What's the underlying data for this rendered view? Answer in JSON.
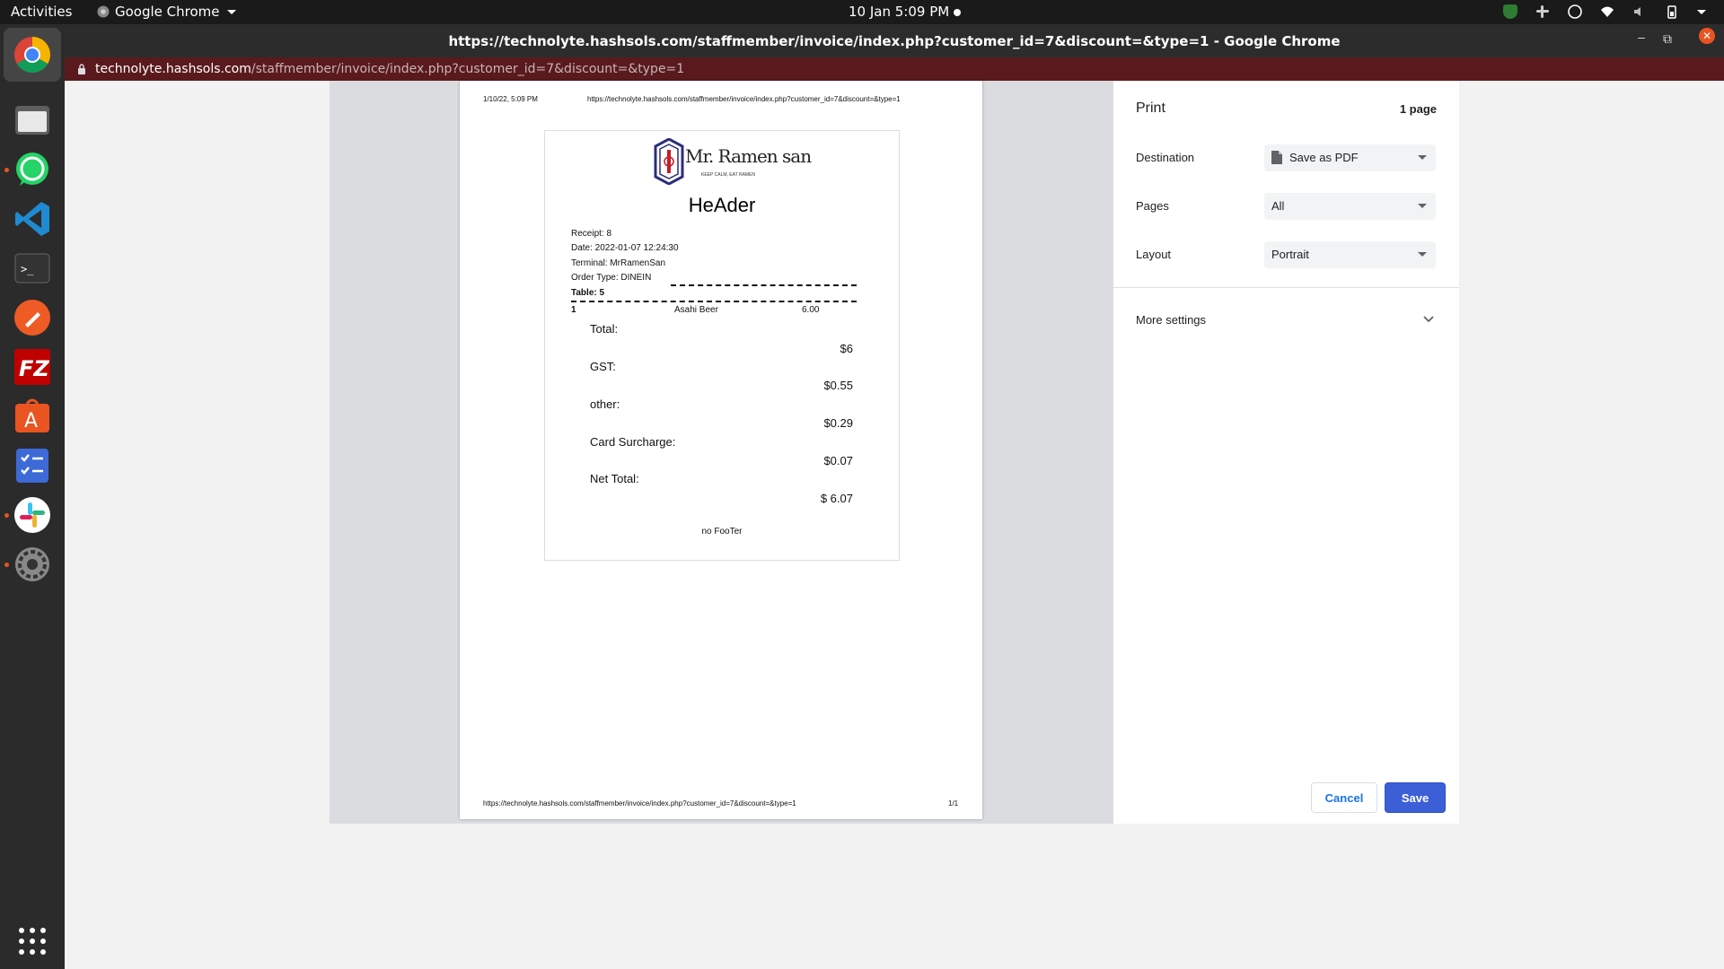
{
  "topbar": {
    "activities": "Activities",
    "app_name": "Google Chrome",
    "clock": "10 Jan  5:09 PM"
  },
  "dock": {
    "items": [
      "chrome-icon",
      "files-icon",
      "whatsapp-icon",
      "vscode-icon",
      "terminal-icon",
      "postman-icon",
      "filezilla-icon",
      "software-center-icon",
      "todo-icon",
      "slack-icon",
      "settings-icon",
      "app-grid-icon"
    ]
  },
  "window": {
    "title": "https://technolyte.hashsols.com/staffmember/invoice/index.php?customer_id=7&discount=&type=1 - Google Chrome",
    "url_host": "technolyte.hashsols.com",
    "url_path": "/staffmember/invoice/index.php?customer_id=7&discount=&type=1"
  },
  "preview": {
    "header_date": "1/10/22, 5:09 PM",
    "header_url": "https://technolyte.hashsols.com/staffmember/invoice/index.php?customer_id=7&discount=&type=1",
    "footer_url": "https://technolyte.hashsols.com/staffmember/invoice/index.php?customer_id=7&discount=&type=1",
    "footer_page": "1/1",
    "receipt": {
      "logo_text": "Mr. Ramen san",
      "logo_tagline": "KEEP CALM, EAT RAMEN",
      "heading": "HeAder",
      "receipt_no": "Receipt: 8",
      "date": "Date: 2022-01-07 12:24:30",
      "terminal": "Terminal: MrRamenSan",
      "order_type": "Order Type: DINEIN",
      "table": "Table:  5",
      "item": {
        "qty": "1",
        "name": "Asahi Beer",
        "price": "6.00"
      },
      "total_label": "Total:",
      "total_value": "$6",
      "gst_label": "GST:",
      "gst_value": "$0.55",
      "other_label": "other:",
      "other_value": "$0.29",
      "surcharge_label": "Card Surcharge:",
      "surcharge_value": "$0.07",
      "net_label": "Net Total:",
      "net_value": "$ 6.07",
      "footer": "no FooTer"
    }
  },
  "print_settings": {
    "title": "Print",
    "page_count": "1 page",
    "destination_label": "Destination",
    "destination_value": "Save as PDF",
    "pages_label": "Pages",
    "pages_value": "All",
    "layout_label": "Layout",
    "layout_value": "Portrait",
    "more_settings": "More settings",
    "cancel": "Cancel",
    "save": "Save"
  }
}
